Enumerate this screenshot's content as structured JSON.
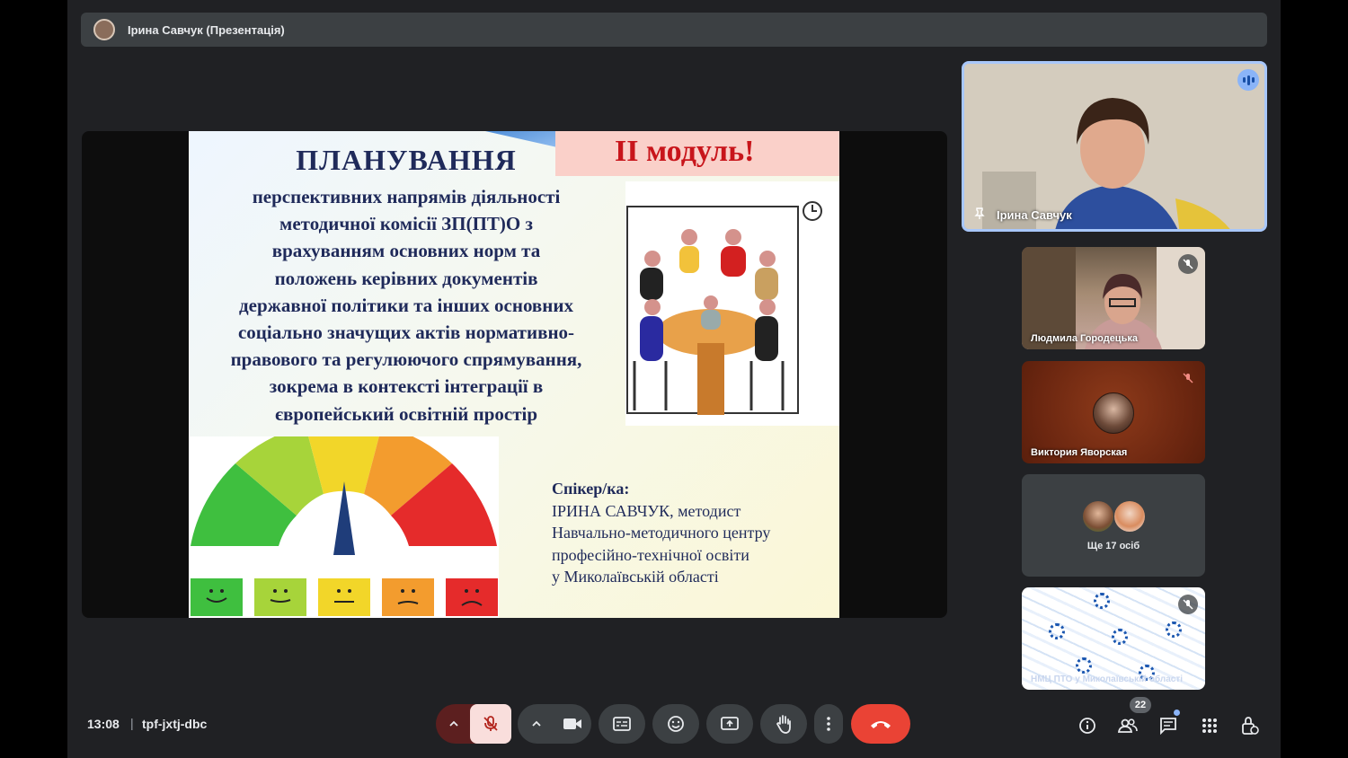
{
  "presenter_bar": {
    "label": "Ірина Савчук (Презентація)"
  },
  "slide": {
    "module_label": "ІІ модуль!",
    "title": "ПЛАНУВАННЯ",
    "body_lines": [
      "перспективних напрямів діяльності",
      "методичної комісії ЗП(ПТ)О з",
      "врахуванням основних норм та",
      "положень керівних документів",
      "державної політики та інших основних",
      "соціально значущих актів нормативно-",
      "правового та регулюючого спрямування,",
      "зокрема в контексті інтеграції в",
      "європейський освітній простір"
    ],
    "speaker_label": "Спікер/ка:",
    "speaker_lines": [
      "ІРИНА САВЧУК, методист",
      "Навчально-методичного центру",
      "професійно-технічної освіти",
      "у Миколаївській області"
    ]
  },
  "participants": {
    "main": {
      "name": "Ірина Савчук"
    },
    "tile2": {
      "name": "Людмила Городецька"
    },
    "tile3": {
      "name": "Виктория Яворская"
    },
    "tile4": {
      "label": "Ще 17 осіб"
    },
    "tile5": {
      "name": "НМЦ ПТО у Миколаївській області"
    }
  },
  "bottom_bar": {
    "time": "13:08",
    "separator": "|",
    "meeting_code": "tpf-jxtj-dbc",
    "people_count": "22"
  },
  "colors": {
    "end_call": "#ea4335",
    "mic_muted_bg": "#f9dedc",
    "speaking_border": "#a8c7fa",
    "module_text": "#c8151b",
    "slide_text": "#1f2a5a"
  }
}
